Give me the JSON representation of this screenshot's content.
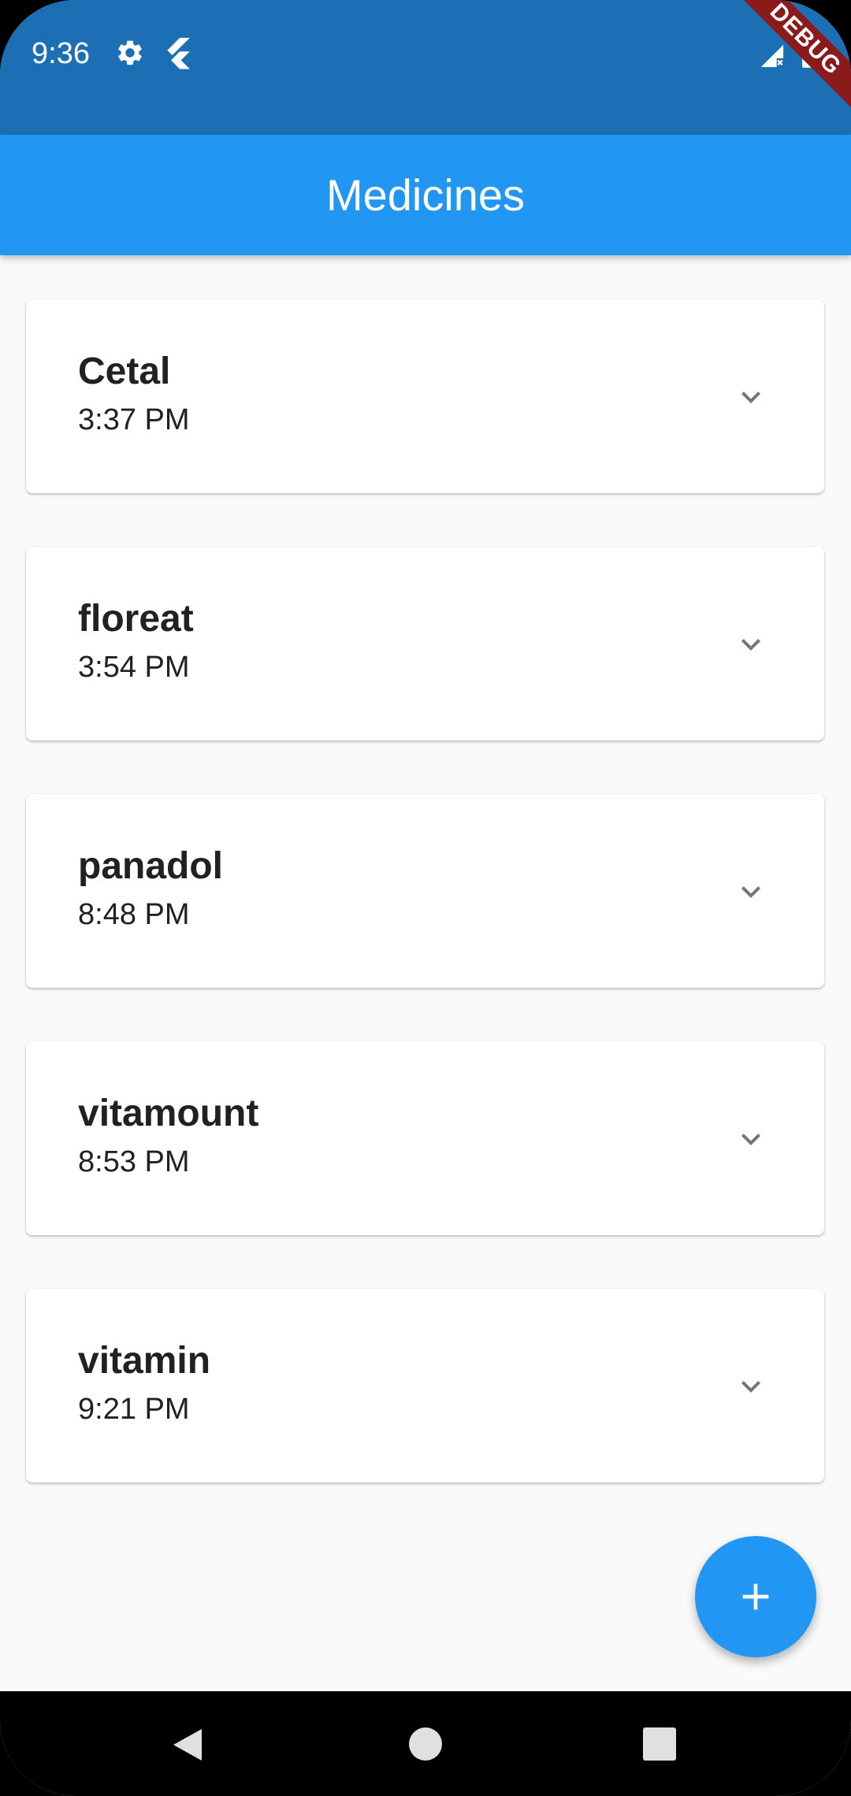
{
  "status_bar": {
    "time": "9:36",
    "icons": [
      "gear-icon",
      "flutter-icon",
      "signal-icon",
      "battery-icon"
    ],
    "debug_banner": "DEBUG"
  },
  "app_bar": {
    "title": "Medicines",
    "color": "#2196f3"
  },
  "medicines": [
    {
      "name": "Cetal",
      "time": "3:37 PM"
    },
    {
      "name": "floreat",
      "time": "3:54 PM"
    },
    {
      "name": "panadol",
      "time": "8:48 PM"
    },
    {
      "name": "vitamount",
      "time": "8:53 PM"
    },
    {
      "name": "vitamin",
      "time": "9:21 PM"
    }
  ],
  "fab": {
    "icon": "plus-icon"
  },
  "nav_bar": {
    "icons": [
      "back-icon",
      "home-icon",
      "recents-icon"
    ]
  }
}
